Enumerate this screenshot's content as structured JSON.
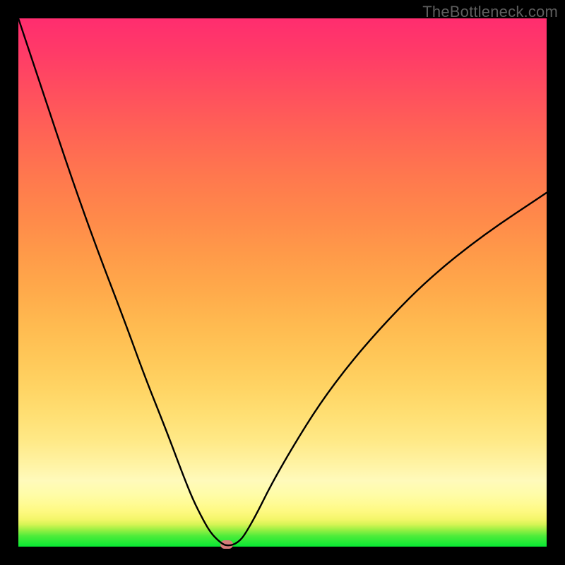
{
  "watermark": "TheBottleneck.com",
  "chart_data": {
    "type": "line",
    "title": "",
    "xlabel": "",
    "ylabel": "",
    "xlim": [
      0,
      100
    ],
    "ylim": [
      0,
      100
    ],
    "grid": false,
    "legend": false,
    "series": [
      {
        "name": "bottleneck-curve",
        "x": [
          0,
          5,
          10,
          15,
          20,
          24,
          28,
          31,
          33,
          35,
          36.5,
          38,
          39,
          40,
          41,
          42,
          43,
          45,
          48,
          52,
          57,
          63,
          70,
          78,
          88,
          100
        ],
        "values": [
          100,
          85,
          70,
          56,
          43,
          32,
          22,
          14,
          9,
          5,
          2.5,
          1,
          0.3,
          0.2,
          0.5,
          1.2,
          2.5,
          6,
          12,
          19,
          27,
          35,
          43,
          51,
          59,
          67
        ]
      }
    ],
    "marker": {
      "x": 39.5,
      "y": 0.4
    },
    "colors": {
      "curve": "#000000",
      "marker": "#d77b7a",
      "gradient_top": "#ff2d6f",
      "gradient_mid": "#ffd464",
      "gradient_bottom": "#07e833"
    }
  }
}
